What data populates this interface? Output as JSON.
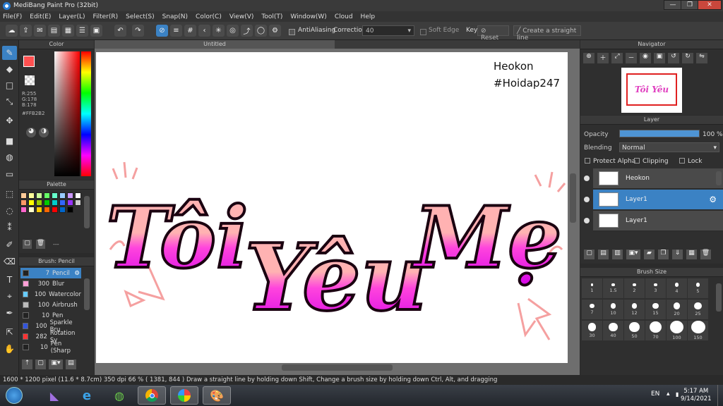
{
  "window": {
    "title": "MediBang Paint Pro (32bit)",
    "minimize": "—",
    "maximize": "❐",
    "close": "✕"
  },
  "menu": [
    "File(F)",
    "Edit(E)",
    "Layer(L)",
    "Filter(R)",
    "Select(S)",
    "Snap(N)",
    "Color(C)",
    "View(V)",
    "Tool(T)",
    "Window(W)",
    "Cloud",
    "Help"
  ],
  "toolbar": {
    "antialiasing": "AntiAliasing",
    "correction_label": "Correction",
    "correction_value": "40",
    "soft_edge": "Soft Edge",
    "key_label": "Key",
    "reset": "Reset",
    "straight_line": "Create a straight line"
  },
  "color_panel": {
    "title": "Color",
    "r": "R:255",
    "g": "G:178",
    "b": "B:178",
    "hex": "#FFB2B2",
    "fg": "#ff5050",
    "accent": "#3b82c4"
  },
  "palette": {
    "title": "Palette",
    "more": "---",
    "swatches": [
      "#ffcc99",
      "#ffff99",
      "#ccff99",
      "#66ff66",
      "#66ffcc",
      "#99ccff",
      "#cc99ff",
      "#ffffff",
      "#ff9966",
      "#ffff00",
      "#99cc00",
      "#00cc00",
      "#00cccc",
      "#3366ff",
      "#9933ff",
      "#cccccc",
      "#ff66cc",
      "#ffffcc",
      "#ffcc00",
      "#ff6600",
      "#ff0000",
      "#0066cc",
      "#000000"
    ]
  },
  "brush_panel": {
    "title": "Brush: Pencil",
    "items": [
      {
        "size": "7",
        "name": "Pencil",
        "color": "#222222"
      },
      {
        "size": "300",
        "name": "Blur",
        "color": "#ff9fd6"
      },
      {
        "size": "100",
        "name": "Watercolor",
        "color": "#66ccff"
      },
      {
        "size": "100",
        "name": "Airbrush",
        "color": "#bbbbbb"
      },
      {
        "size": "10",
        "name": "Pen",
        "color": "#222222"
      },
      {
        "size": "100",
        "name": "Sparkle Bru",
        "color": "#3355dd"
      },
      {
        "size": "282",
        "name": "Rotation Sy",
        "color": "#ff3333"
      },
      {
        "size": "10",
        "name": "Pen (Sharp",
        "color": "#222222"
      }
    ]
  },
  "canvas": {
    "tab": "Untitled",
    "watermark_line1": "Heokon",
    "watermark_line2": "#Hoidap247",
    "artwork_text": "Tôi Yêu Mẹ"
  },
  "navigator": {
    "title": "Navigator"
  },
  "layer_panel": {
    "title": "Layer",
    "opacity_label": "Opacity",
    "opacity_value": "100 %",
    "opacity_fraction": 1.0,
    "blending_label": "Blending",
    "blending_value": "Normal",
    "protect_alpha": "Protect Alpha",
    "clipping": "Clipping",
    "lock": "Lock",
    "layers": [
      {
        "name": "Heokon",
        "selected": false
      },
      {
        "name": "Layer1",
        "selected": true
      },
      {
        "name": "Layer1",
        "selected": false
      }
    ]
  },
  "brush_size": {
    "title": "Brush Size",
    "sizes": [
      "1",
      "1.5",
      "2",
      "3",
      "4",
      "5",
      "7",
      "10",
      "12",
      "15",
      "20",
      "25",
      "30",
      "40",
      "50",
      "70",
      "100",
      "150"
    ]
  },
  "status": {
    "dims": "1600 * 1200 pixel",
    "cm": "(11.6 * 8.7cm)",
    "dpi": "350 dpi",
    "zoom": "66 %",
    "coords": "( 1381, 844 )",
    "hint": "Draw a straight line by holding down Shift, Change a brush size by holding down Ctrl, Alt, and dragging"
  },
  "taskbar": {
    "lang": "EN",
    "time": "5:17 AM",
    "date": "9/14/2021"
  }
}
